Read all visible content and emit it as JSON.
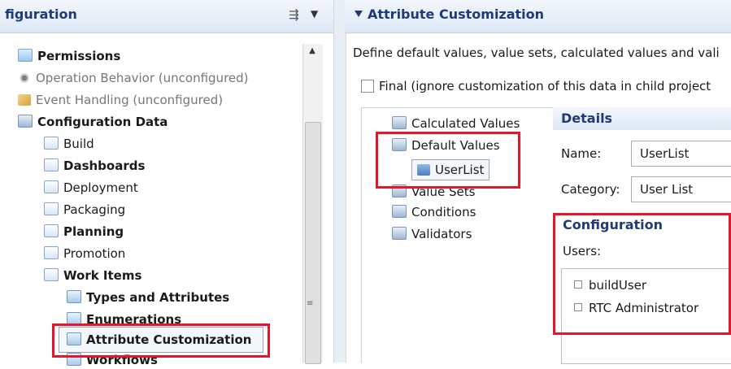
{
  "left_panel": {
    "title": "figuration",
    "tree": [
      {
        "label": "Permissions",
        "icon": "permissions-icon",
        "bold": true
      },
      {
        "label": "Operation Behavior (unconfigured)",
        "icon": "gear-icon",
        "muted": true
      },
      {
        "label": "Event Handling (unconfigured)",
        "icon": "event-icon",
        "muted": true
      },
      {
        "label": "Configuration Data",
        "icon": "folder-icon",
        "bold": true
      },
      {
        "label": "Build",
        "icon": "page-icon"
      },
      {
        "label": "Dashboards",
        "icon": "page-icon",
        "bold": true
      },
      {
        "label": "Deployment",
        "icon": "page-icon"
      },
      {
        "label": "Packaging",
        "icon": "page-icon"
      },
      {
        "label": "Planning",
        "icon": "page-icon",
        "bold": true
      },
      {
        "label": "Promotion",
        "icon": "page-icon"
      },
      {
        "label": "Work Items",
        "icon": "page-icon",
        "bold": true
      },
      {
        "label": "Types and Attributes",
        "icon": "type-icon",
        "bold": true
      },
      {
        "label": "Enumerations",
        "icon": "type-icon",
        "bold": true
      },
      {
        "label": "Attribute Customization",
        "icon": "type-icon",
        "bold": true
      },
      {
        "label": "Workflows",
        "icon": "type-icon",
        "bold": true
      }
    ]
  },
  "right_panel": {
    "section_title": "Attribute Customization",
    "description": "Define default values, value sets, calculated values and vali",
    "final_label": "Final (ignore customization of this data in child project",
    "categories": [
      {
        "label": "Calculated Values"
      },
      {
        "label": "Default Values"
      },
      {
        "label": "UserList"
      },
      {
        "label": "Value Sets"
      },
      {
        "label": "Conditions"
      },
      {
        "label": "Validators"
      }
    ],
    "details": {
      "header": "Details",
      "name_label": "Name:",
      "name_value": "UserList",
      "category_label": "Category:",
      "category_value": "User List"
    },
    "configuration": {
      "header": "Configuration",
      "users_label": "Users:",
      "users": [
        "buildUser",
        "RTC Administrator"
      ]
    }
  },
  "colors": {
    "highlight": "#e3162b",
    "header_text": "#1e3a78"
  }
}
